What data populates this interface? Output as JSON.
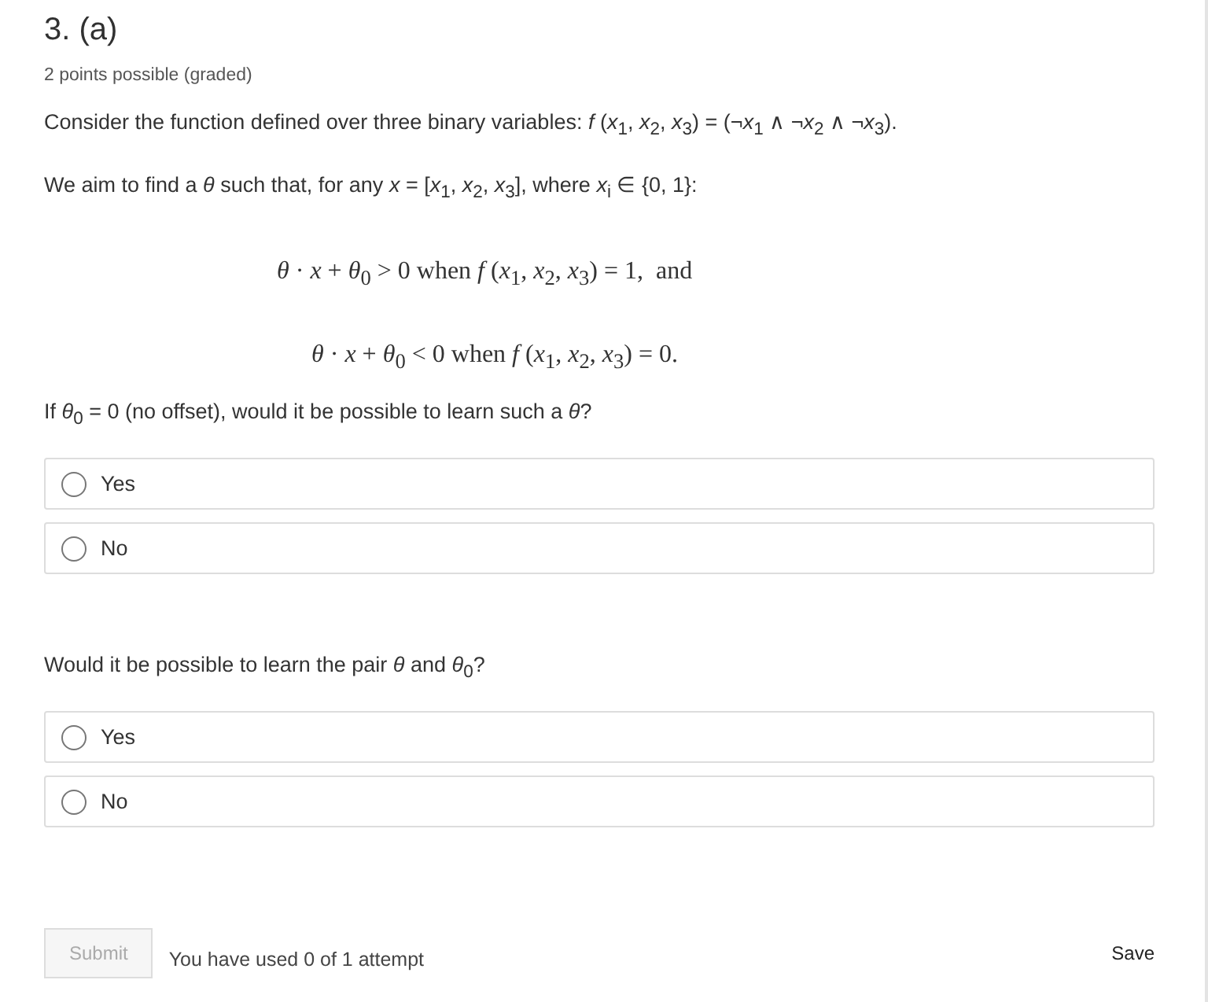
{
  "problem": {
    "title": "3. (a)",
    "points": "2 points possible (graded)",
    "intro": "Consider the function defined over three binary variables: *f* (*x*$_{1}$, *x*$_{2}$, *x*$_{3}$) = (¬*x*$_{1}$ ∧ ¬*x*$_{2}$ ∧ ¬*x*$_{3}$).",
    "aim": "We aim to find a *θ* such that, for any *x* = [*x*$_{1}$, *x*$_{2}$, *x*$_{3}$], where *x*$_{i}$ ∈ {0, 1}:",
    "equations": [
      "*θ* · *x* + *θ*$_{0}$ > 0 when *f* (*x*$_{1}$, *x*$_{2}$, *x*$_{3}$) = 1,  and",
      "*θ* · *x* + *θ*$_{0}$ < 0 when *f* (*x*$_{1}$, *x*$_{2}$, *x*$_{3}$) = 0."
    ]
  },
  "questions": [
    {
      "prompt": "If *θ*$_{0}$ = 0 (no offset), would it be possible to learn such a *θ*?",
      "options": [
        {
          "label": "Yes",
          "selected": false
        },
        {
          "label": "No",
          "selected": false
        }
      ]
    },
    {
      "prompt": "Would it be possible to learn the pair *θ* and *θ*$_{0}$?",
      "options": [
        {
          "label": "Yes",
          "selected": false
        },
        {
          "label": "No",
          "selected": false
        }
      ]
    }
  ],
  "footer": {
    "submit": {
      "label": "Submit",
      "disabled": true
    },
    "attempts": "You have used 0 of 1 attempt",
    "save": "Save"
  }
}
